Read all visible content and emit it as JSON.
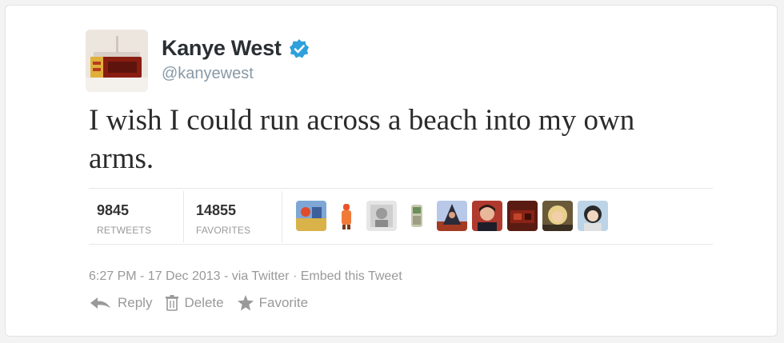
{
  "user": {
    "name": "Kanye West",
    "handle": "@kanyewest",
    "verified": true,
    "accent_color": "#2ea0db"
  },
  "tweet": {
    "text": "I wish I could run across a beach into my own arms."
  },
  "stats": {
    "retweets": {
      "value": "9845",
      "label": "RETWEETS"
    },
    "favorites": {
      "value": "14855",
      "label": "FAVORITES"
    }
  },
  "favoriters": [
    "avatar-1",
    "avatar-2",
    "avatar-3",
    "avatar-4",
    "avatar-5",
    "avatar-6",
    "avatar-7",
    "avatar-8",
    "avatar-9"
  ],
  "meta": {
    "timestamp": "6:27 PM - 17 Dec 2013",
    "via": "via Twitter",
    "separator": "·",
    "embed": "Embed this Tweet"
  },
  "actions": {
    "reply": "Reply",
    "delete": "Delete",
    "favorite": "Favorite"
  },
  "icons": {
    "verified": "verified-badge-icon",
    "reply": "reply-arrow-icon",
    "delete": "trash-icon",
    "favorite": "star-icon"
  }
}
